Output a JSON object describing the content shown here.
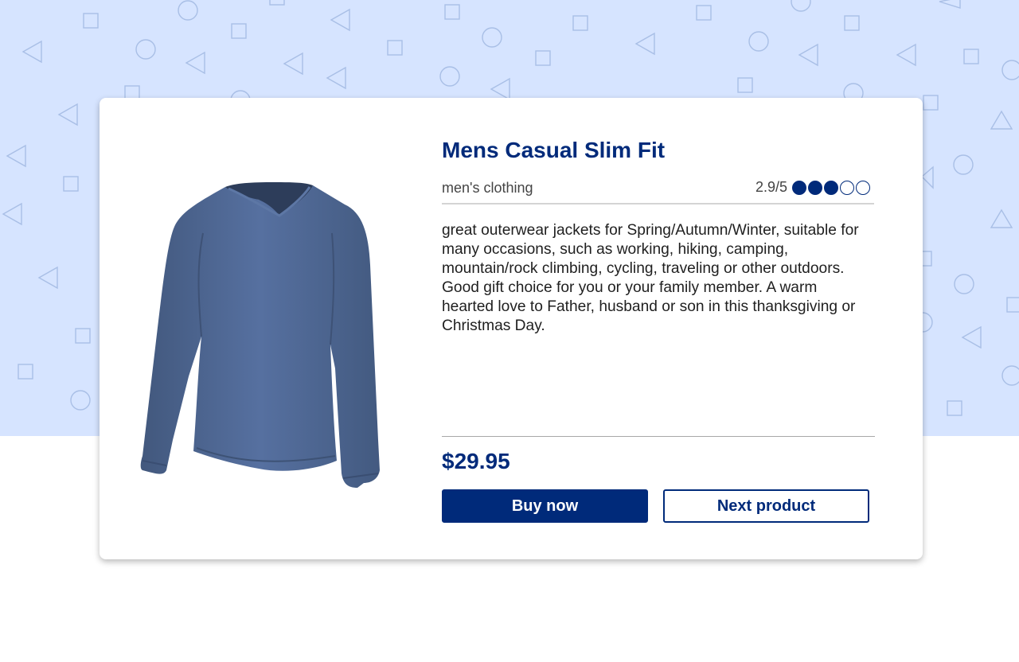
{
  "theme": {
    "accent": "#002a7a",
    "background_pattern": "#d6e4ff"
  },
  "product": {
    "title": "Mens Casual Slim Fit",
    "category": "men's clothing",
    "rating_text": "2.9/5",
    "rating_value": 2.9,
    "rating_max": 5,
    "rating_filled_dots": 3,
    "description": "great outerwear jackets for Spring/Autumn/Winter, suitable for many occasions, such as working, hiking, camping, mountain/rock climbing, cycling, traveling or other outdoors. Good gift choice for you or your family member. A warm hearted love to Father, husband or son in this thanksgiving or Christmas Day.",
    "price": "$29.95",
    "image_icon": "long-sleeve-v-neck-tshirt",
    "image_color": "#4f6890"
  },
  "actions": {
    "buy_label": "Buy now",
    "next_label": "Next product"
  }
}
